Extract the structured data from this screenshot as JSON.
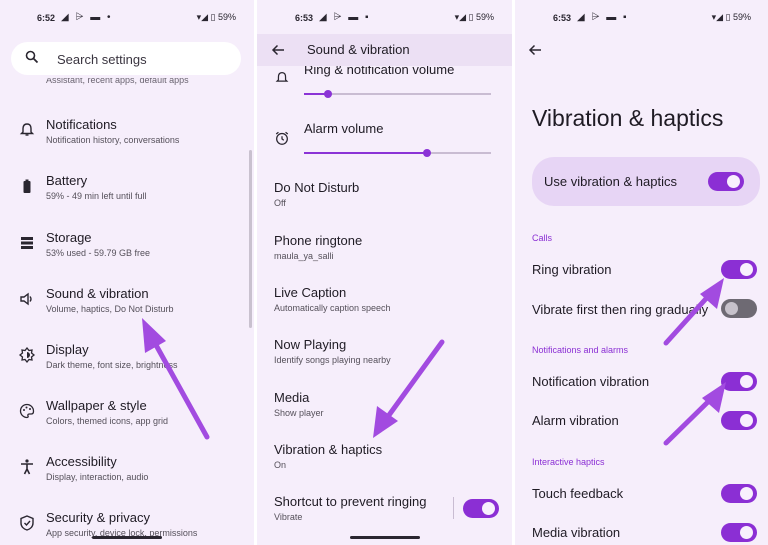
{
  "panel1": {
    "status": {
      "time": "6:52",
      "battery": "59%"
    },
    "search_placeholder": "Search settings",
    "cutoff_text": "Assistant, recent apps, default apps",
    "items": [
      {
        "title": "Notifications",
        "subtitle": "Notification history, conversations",
        "icon": "bell-icon"
      },
      {
        "title": "Battery",
        "subtitle": "59% - 49 min left until full",
        "icon": "battery-icon"
      },
      {
        "title": "Storage",
        "subtitle": "53% used - 59.79 GB free",
        "icon": "storage-icon"
      },
      {
        "title": "Sound & vibration",
        "subtitle": "Volume, haptics, Do Not Disturb",
        "icon": "speaker-icon"
      },
      {
        "title": "Display",
        "subtitle": "Dark theme, font size, brightness",
        "icon": "brightness-icon"
      },
      {
        "title": "Wallpaper & style",
        "subtitle": "Colors, themed icons, app grid",
        "icon": "palette-icon"
      },
      {
        "title": "Accessibility",
        "subtitle": "Display, interaction, audio",
        "icon": "accessibility-icon"
      },
      {
        "title": "Security & privacy",
        "subtitle": "App security, device lock, permissions",
        "icon": "shield-icon"
      }
    ]
  },
  "panel2": {
    "status": {
      "time": "6:53",
      "battery": "59%"
    },
    "title": "Sound & vibration",
    "ring_volume_label": "Ring & notification volume",
    "ring_volume_level": 0.13,
    "alarm_volume_label": "Alarm volume",
    "alarm_volume_level": 0.66,
    "items": [
      {
        "title": "Do Not Disturb",
        "subtitle": "Off"
      },
      {
        "title": "Phone ringtone",
        "subtitle": "maula_ya_salli"
      },
      {
        "title": "Live Caption",
        "subtitle": "Automatically caption speech"
      },
      {
        "title": "Now Playing",
        "subtitle": "Identify songs playing nearby"
      },
      {
        "title": "Media",
        "subtitle": "Show player"
      },
      {
        "title": "Vibration & haptics",
        "subtitle": "On"
      },
      {
        "title": "Shortcut to prevent ringing",
        "subtitle": "Vibrate"
      }
    ]
  },
  "panel3": {
    "status": {
      "time": "6:53",
      "battery": "59%"
    },
    "title": "Vibration & haptics",
    "main_toggle_label": "Use vibration & haptics",
    "sections": {
      "calls": "Calls",
      "notifications": "Notifications and alarms",
      "interactive": "Interactive haptics"
    },
    "rows": {
      "ring_vibration": "Ring vibration",
      "vibrate_first": "Vibrate first then ring gradually",
      "notification_vibration": "Notification vibration",
      "alarm_vibration": "Alarm vibration",
      "touch_feedback": "Touch feedback",
      "media_vibration": "Media vibration"
    }
  },
  "colors": {
    "panel_bg": "#f6eefb",
    "accent": "#8b2fd4",
    "arrow": "#a24be0"
  }
}
